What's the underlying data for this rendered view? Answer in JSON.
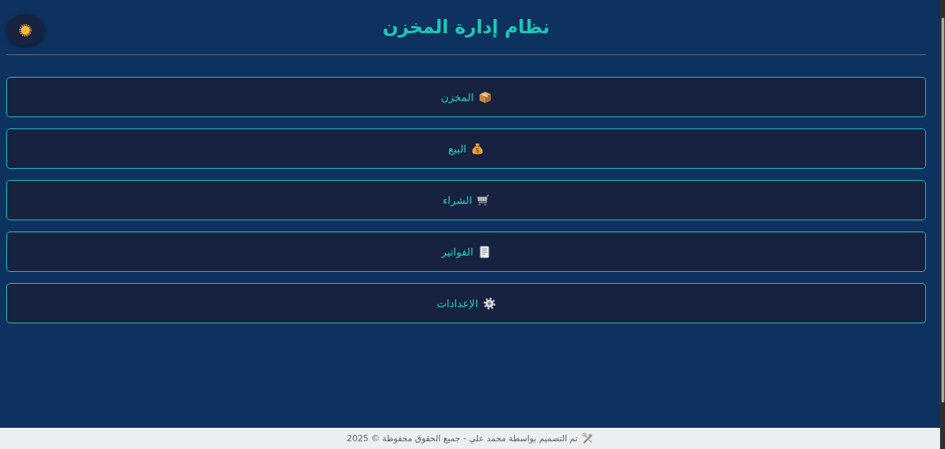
{
  "header": {
    "title": "نظام إدارة المخزن"
  },
  "menu": [
    {
      "label": "المخزن"
    },
    {
      "label": "البيع"
    },
    {
      "label": "الشراء"
    },
    {
      "label": "الفواتير"
    },
    {
      "label": "الإعدادات"
    }
  ],
  "footer": {
    "text": "تم التصميم بواسطة محمد علي - جميع الحقوق محفوظة © 2025"
  }
}
